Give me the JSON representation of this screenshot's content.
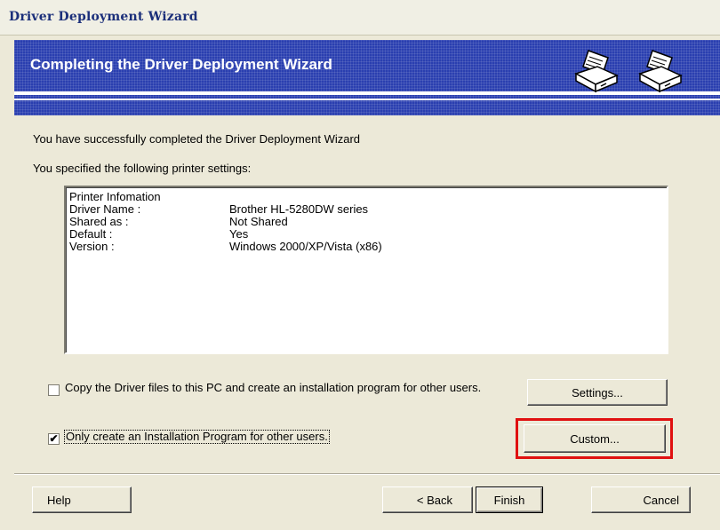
{
  "window": {
    "title": "Driver Deployment Wizard"
  },
  "banner": {
    "title": "Completing the Driver Deployment Wizard",
    "icons": [
      "printer-icon",
      "printer-icon"
    ]
  },
  "main": {
    "success_message": "You have successfully completed the Driver Deployment Wizard",
    "settings_intro": "You specified the following printer settings:",
    "printer_info": {
      "header": "Printer Infomation",
      "rows": [
        {
          "label": "Driver Name :",
          "value": "Brother HL-5280DW series"
        },
        {
          "label": "Shared as :",
          "value": "Not Shared"
        },
        {
          "label": "Default :",
          "value": "Yes"
        },
        {
          "label": "Version :",
          "value": "Windows 2000/XP/Vista (x86)"
        }
      ]
    },
    "options": {
      "copy_files": {
        "label": "Copy the Driver files to this PC and create an installation program for other users.",
        "checked": false
      },
      "only_install": {
        "label": "Only create an Installation Program for other users.",
        "checked": true
      }
    },
    "settings_button": "Settings...",
    "custom_button": "Custom..."
  },
  "footer": {
    "help": "Help",
    "back": "< Back",
    "finish": "Finish",
    "cancel": "Cancel"
  },
  "colors": {
    "banner": "#2a3fb0",
    "highlight": "#e01010",
    "dialog": "#ece9d8"
  }
}
